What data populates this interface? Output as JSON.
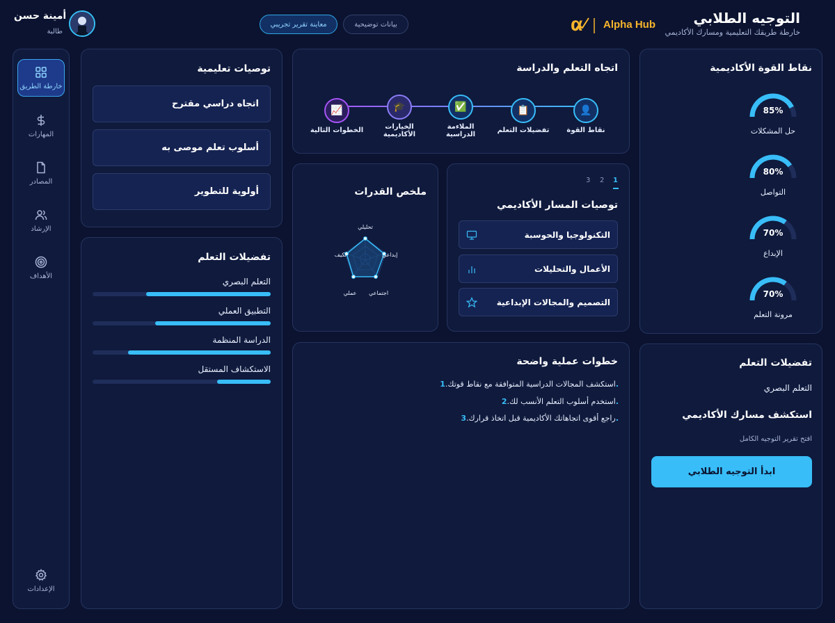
{
  "header": {
    "title": "التوجيه الطلابي",
    "subtitle": "خارطة طريقك التعليمية ومسارك الأكاديمي",
    "logo_text": "Alpha Hub",
    "demo_label": "بيانات توضيحية",
    "preview_label": "معاينة تقرير تجريبي",
    "user_name": "أمينة حسن",
    "user_role": "طالبة"
  },
  "sidebar": {
    "items": [
      {
        "label": "خارطة الطريق",
        "icon": "grid-icon"
      },
      {
        "label": "المهارات",
        "icon": "dollar-icon"
      },
      {
        "label": "المصادر",
        "icon": "document-icon"
      },
      {
        "label": "الإرشاد",
        "icon": "users-icon"
      },
      {
        "label": "الأهداف",
        "icon": "target-icon"
      }
    ],
    "settings_label": "الإعدادات"
  },
  "strengths": {
    "title": "نقاط القوة الأكاديمية",
    "items": [
      {
        "label": "حل المشكلات",
        "value": 85,
        "display": "85%"
      },
      {
        "label": "التواصل",
        "value": 80,
        "display": "80%"
      },
      {
        "label": "الإبداع",
        "value": 70,
        "display": "70%"
      },
      {
        "label": "مرونة التعلم",
        "value": 70,
        "display": "70%"
      }
    ]
  },
  "learning_direction": {
    "title": "اتجاه التعلم والدراسة",
    "steps": [
      {
        "label": "نقاط القوة",
        "icon": "student-icon",
        "glyph": "👤"
      },
      {
        "label": "تفضيلات التعلم",
        "icon": "clipboard-icon",
        "glyph": "📋"
      },
      {
        "label": "الملاءمة الدراسية",
        "icon": "check-icon",
        "glyph": "✅"
      },
      {
        "label": "الخيارات الأكاديمية",
        "icon": "graduation-cap-icon",
        "glyph": "🎓"
      },
      {
        "label": "الخطوات التالية",
        "icon": "chart-up-icon",
        "glyph": "📈"
      }
    ]
  },
  "recommendations": {
    "title": "توصيات تعليمية",
    "items": [
      "اتجاه دراسي مقترح",
      "أسلوب تعلم موصى به",
      "أولوية للتطوير"
    ]
  },
  "learning_preferences": {
    "title": "تفضيلات التعلم",
    "items": [
      {
        "label": "التعلم البصري",
        "value": 0.7
      },
      {
        "label": "التطبيق العملي",
        "value": 0.65
      },
      {
        "label": "الدراسة المنظمة",
        "value": 0.8
      },
      {
        "label": "الاستكشاف المستقل",
        "value": 0.3
      }
    ]
  },
  "academic_path": {
    "title": "توصيات المسار الأكاديمي",
    "pages": [
      "1",
      "2",
      "3"
    ],
    "active_page": "1",
    "items": [
      {
        "label": "التكنولوجيا والحوسبة",
        "icon": "monitor-icon"
      },
      {
        "label": "الأعمال والتحليلات",
        "icon": "bar-chart-icon"
      },
      {
        "label": "التصميم والمجالات الإبداعية",
        "icon": "star-icon"
      }
    ]
  },
  "abilities": {
    "title": "ملخص القدرات",
    "axes": [
      "تحليلي",
      "إبداعي",
      "اجتماعي",
      "عملي",
      "تكيف"
    ]
  },
  "practical_steps": {
    "title": "خطوات عملية واضحة",
    "items": [
      {
        "num": "1.",
        "text": "استكشف المجالات الدراسية المتوافقة مع نقاط قوتك."
      },
      {
        "num": "2.",
        "text": "استخدم أسلوب التعلم الأنسب لك."
      },
      {
        "num": "3.",
        "text": "راجع أقوى اتجاهاتك الأكاديمية قبل اتخاذ قرارك."
      }
    ]
  },
  "cta": {
    "title": "تفضيلات التعلم",
    "preference": "التعلم البصري",
    "heading": "استكشف مسارك الأكاديمي",
    "note": "افتح تقرير التوجيه الكامل",
    "button_label": "ابدأ التوجيه الطلابي"
  },
  "colors": {
    "background": "#0b1330",
    "panel": "#0f1a3d",
    "accent": "#38bdf8",
    "logo": "#f7b52c"
  }
}
